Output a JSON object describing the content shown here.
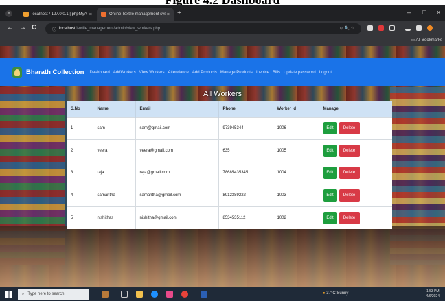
{
  "caption": "Figure 4.2 Dashboard",
  "browser": {
    "tabs": [
      {
        "title": "localhost / 127.0.0.1 | phpMyA",
        "favicon_color": "#f0a030",
        "close": "×"
      },
      {
        "title": "Online Textile management sys",
        "favicon_color": "#f07030",
        "close": "×"
      }
    ],
    "new_tab": "+",
    "tab_menu": "˅",
    "window_controls": {
      "minimize": "–",
      "maximize": "□",
      "close": "×"
    },
    "nav": {
      "back": "←",
      "forward": "→",
      "reload": "C"
    },
    "address": {
      "host": "localhost",
      "path": "/textile_management/admin/view_workers.php",
      "right_icons": "⊙  🔍  ☆"
    },
    "bookmarks_label": "All Bookmarks"
  },
  "site": {
    "brand": "Bharath Collection",
    "nav_links": [
      "Dashboard",
      "AddWorkers",
      "View Workers",
      "Attendance",
      "Add Products",
      "Manage Products",
      "Invoice",
      "Bills",
      "Update password",
      "Logout"
    ]
  },
  "workers": {
    "title": "All Workers",
    "columns": [
      "S.No",
      "Name",
      "Email",
      "Phone",
      "Worker id",
      "Manage"
    ],
    "edit_label": "Edit",
    "delete_label": "Delete",
    "rows": [
      {
        "sno": "1",
        "name": "sam",
        "email": "sam@gmail.com",
        "phone": "973945344",
        "worker_id": "1006"
      },
      {
        "sno": "2",
        "name": "veera",
        "email": "veera@gmail.com",
        "phone": "635",
        "worker_id": "1005"
      },
      {
        "sno": "3",
        "name": "raja",
        "email": "raja@gmail.com",
        "phone": "78685435345",
        "worker_id": "1004"
      },
      {
        "sno": "4",
        "name": "samantha",
        "email": "samantha@gmail.com",
        "phone": "8912389222",
        "worker_id": "1003"
      },
      {
        "sno": "5",
        "name": "nishithas",
        "email": "nishitha@gmail.com",
        "phone": "8534535112",
        "worker_id": "1002"
      }
    ]
  },
  "taskbar": {
    "search_placeholder": "Type here to search",
    "weather": "37°C Sunny",
    "time": "1:53 PM",
    "date": "4/6/2024"
  }
}
